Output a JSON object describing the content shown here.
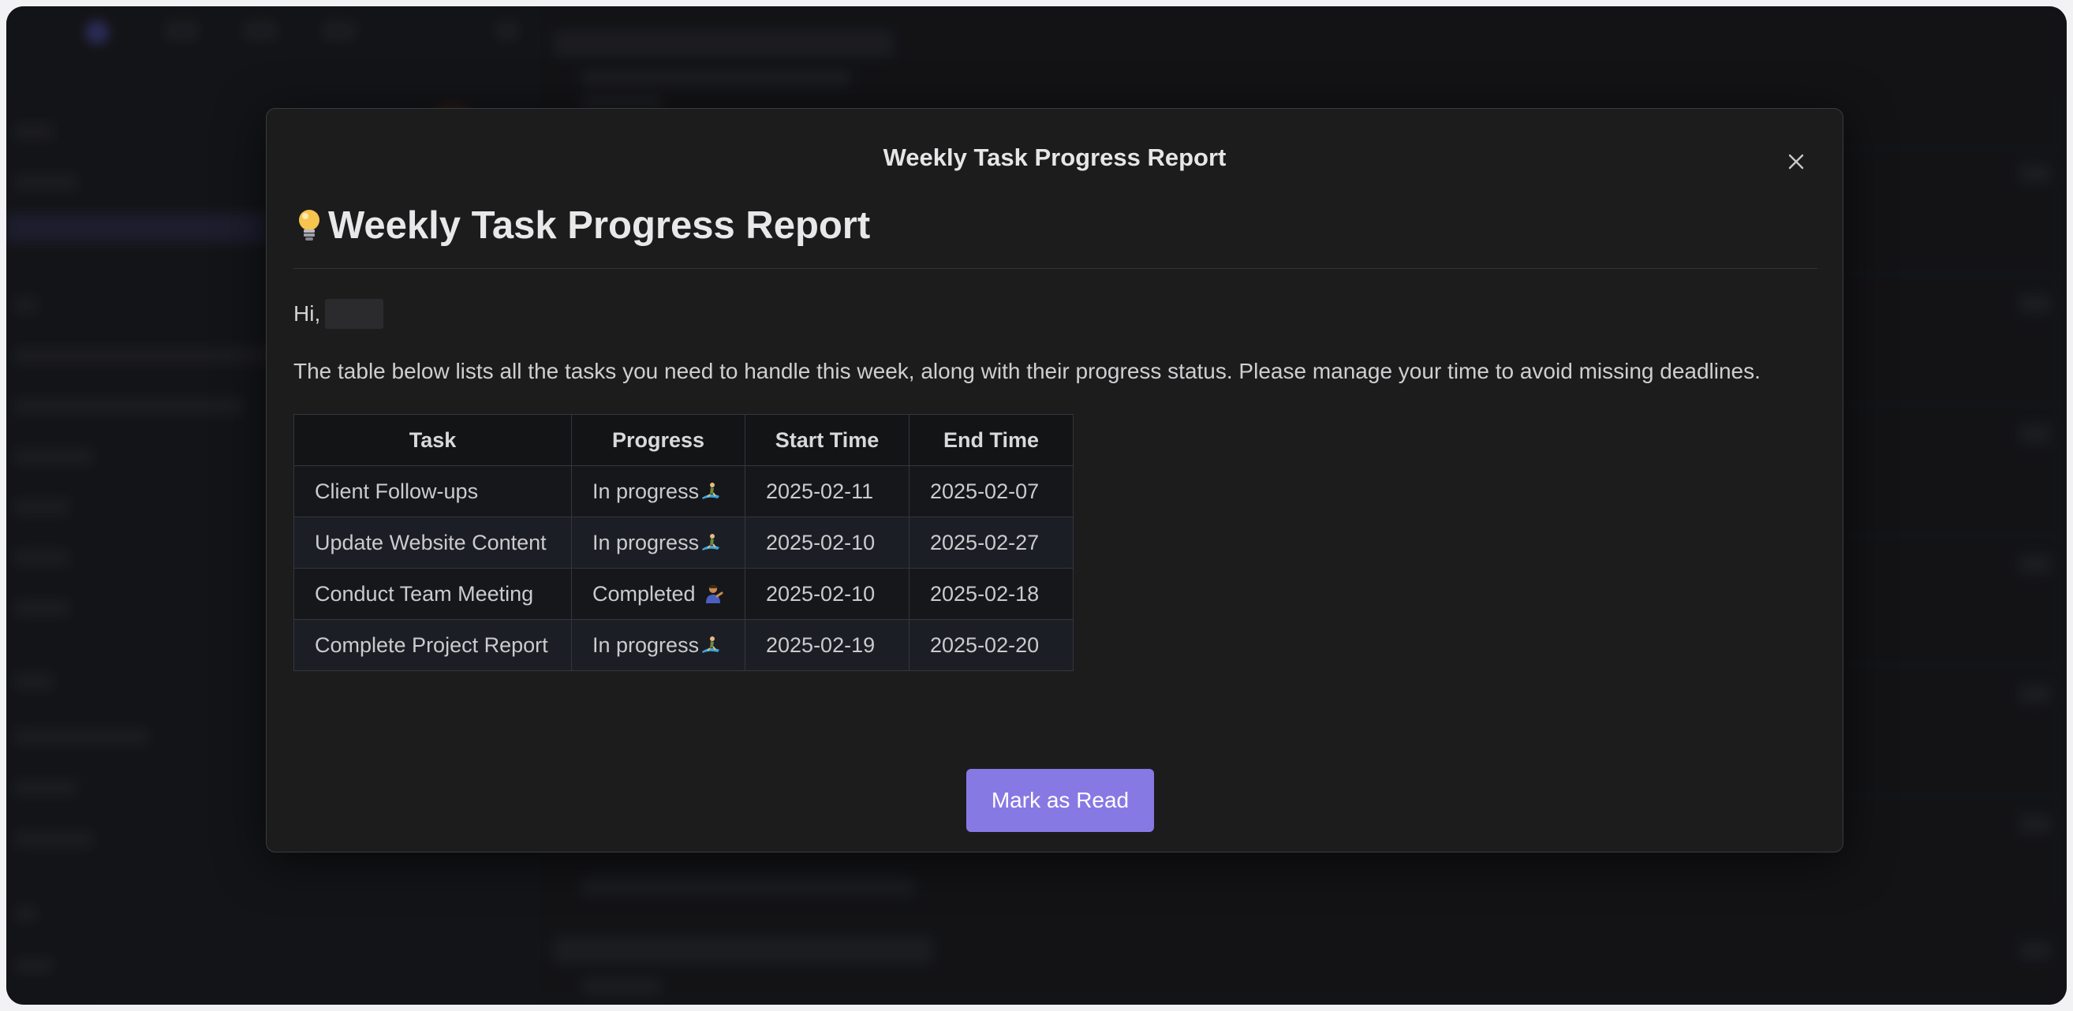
{
  "modal": {
    "title": "Weekly Task Progress Report",
    "heading": "Weekly Task Progress Report",
    "greeting": "Hi,",
    "intro": "The table below lists all the tasks you need to handle this week, along with their progress status. Please manage your time to avoid missing deadlines.",
    "table": {
      "headers": [
        "Task",
        "Progress",
        "Start Time",
        "End Time"
      ],
      "rows": [
        {
          "task": "Client Follow-ups",
          "progress": "In progress",
          "progress_icon": "surfer-emoji",
          "start": "2025-02-11",
          "end": "2025-02-07"
        },
        {
          "task": "Update Website Content",
          "progress": "In progress",
          "progress_icon": "surfer-emoji",
          "start": "2025-02-10",
          "end": "2025-02-27"
        },
        {
          "task": "Conduct Team Meeting",
          "progress": "Completed",
          "progress_icon": "person-emoji",
          "start": "2025-02-10",
          "end": "2025-02-18"
        },
        {
          "task": "Complete Project Report",
          "progress": "In progress",
          "progress_icon": "surfer-emoji",
          "start": "2025-02-19",
          "end": "2025-02-20"
        }
      ]
    },
    "button_label": "Mark as Read"
  },
  "icons": {
    "heading": "lightbulb-icon",
    "close": "close-icon"
  },
  "colors": {
    "accent": "#8779e3",
    "modal_bg": "#1c1c1d",
    "overlay": "#0a0a0c"
  }
}
